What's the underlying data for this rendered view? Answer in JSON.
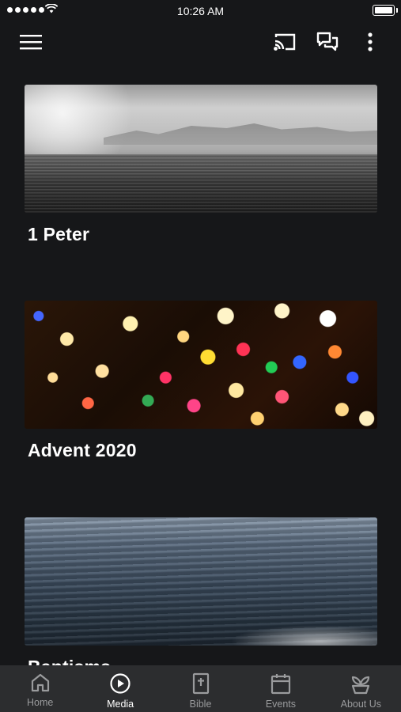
{
  "status": {
    "time": "10:26 AM"
  },
  "toolbar": {
    "menu_icon": "hamburger-menu-icon",
    "cast_icon": "cast-icon",
    "chat_icon": "chat-icon",
    "more_icon": "more-vertical-icon"
  },
  "media_items": [
    {
      "title": "1 Peter"
    },
    {
      "title": "Advent 2020"
    },
    {
      "title": "Baptisms"
    }
  ],
  "tabs": [
    {
      "label": "Home",
      "icon": "home-icon",
      "active": false
    },
    {
      "label": "Media",
      "icon": "play-circle-icon",
      "active": true
    },
    {
      "label": "Bible",
      "icon": "bible-icon",
      "active": false
    },
    {
      "label": "Events",
      "icon": "calendar-icon",
      "active": false
    },
    {
      "label": "About Us",
      "icon": "plant-icon",
      "active": false
    }
  ],
  "colors": {
    "background": "#161719",
    "tabbar": "#2c2d2f",
    "tab_inactive": "#9a9b9d",
    "tab_active": "#ffffff"
  }
}
